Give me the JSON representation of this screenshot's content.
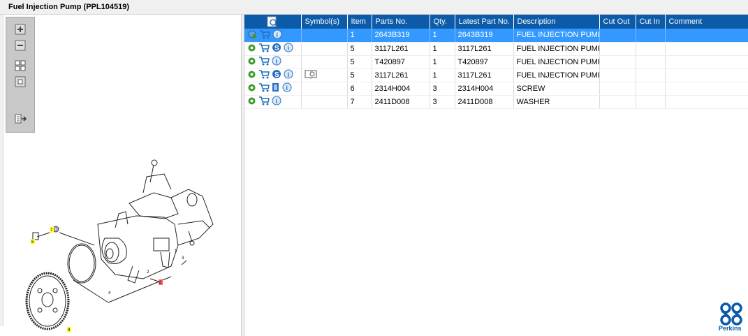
{
  "window": {
    "title": "Fuel Injection Pump (PPL104519)"
  },
  "toolbar": {
    "buttons": [
      "zoom-in",
      "zoom-out",
      "fit-all",
      "fit-window",
      "export"
    ]
  },
  "diagram": {
    "callouts": [
      "6",
      "7",
      "9",
      "8",
      "1",
      "2",
      "3",
      "4"
    ]
  },
  "table": {
    "columns": [
      "",
      "Symbol(s)",
      "Item",
      "Parts No.",
      "Qty.",
      "Latest Part No.",
      "Description",
      "Cut Out",
      "Cut In",
      "Comment"
    ],
    "rows": [
      {
        "icons": [
          "settings-icon",
          "cart-icon",
          "info-icon"
        ],
        "symbol": "",
        "item": "1",
        "part": "2643B319",
        "qty": "1",
        "latest": "2643B319",
        "desc": "FUEL INJECTION PUMP",
        "cutout": "",
        "cutin": "",
        "comment": "",
        "selected": true
      },
      {
        "icons": [
          "gear-icon",
          "cart-icon",
          "s-icon",
          "info-icon"
        ],
        "symbol": "",
        "item": "5",
        "part": "3117L261",
        "qty": "1",
        "latest": "3117L261",
        "desc": "FUEL INJECTION PUMP (",
        "cutout": "",
        "cutin": "",
        "comment": ""
      },
      {
        "icons": [
          "gear-icon",
          "cart-icon",
          "info-icon"
        ],
        "symbol": "",
        "item": "5",
        "part": "T420897",
        "qty": "1",
        "latest": "T420897",
        "desc": "FUEL INJECTION PUMP (",
        "cutout": "",
        "cutin": "",
        "comment": ""
      },
      {
        "icons": [
          "gear-icon",
          "cart-icon",
          "s-icon",
          "info-icon"
        ],
        "symbol": "book-icon",
        "item": "5",
        "part": "3117L261",
        "qty": "1",
        "latest": "3117L261",
        "desc": "FUEL INJECTION PUMP (",
        "cutout": "",
        "cutin": "",
        "comment": ""
      },
      {
        "icons": [
          "gear-icon",
          "cart-icon",
          "doc-icon",
          "info-icon"
        ],
        "symbol": "",
        "item": "6",
        "part": "2314H004",
        "qty": "3",
        "latest": "2314H004",
        "desc": "SCREW",
        "cutout": "",
        "cutin": "",
        "comment": ""
      },
      {
        "icons": [
          "gear-icon",
          "cart-icon",
          "info-icon"
        ],
        "symbol": "",
        "item": "7",
        "part": "2411D008",
        "qty": "3",
        "latest": "2411D008",
        "desc": "WASHER",
        "cutout": "",
        "cutin": "",
        "comment": ""
      }
    ]
  },
  "brand": {
    "name": "Perkins",
    "color": "#0a5aa8"
  },
  "colors": {
    "header": "#0c5ba8",
    "selected": "#3399ff",
    "gear": "#3a9a2a",
    "callout": "#ffff33"
  }
}
